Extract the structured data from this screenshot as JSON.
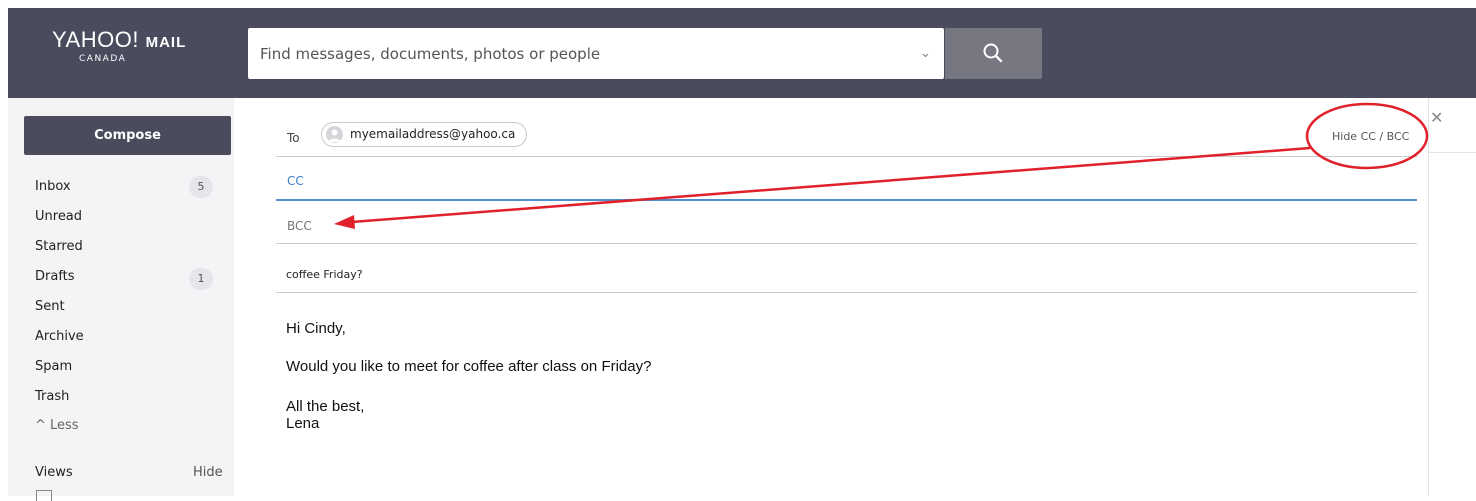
{
  "header": {
    "logo_main": "YAHOO!",
    "logo_mail": "MAIL",
    "logo_sub": "CANADA",
    "search_placeholder": "Find messages, documents, photos or people"
  },
  "sidebar": {
    "compose_label": "Compose",
    "folders": [
      {
        "label": "Inbox",
        "count": "5"
      },
      {
        "label": "Unread"
      },
      {
        "label": "Starred"
      },
      {
        "label": "Drafts",
        "count": "1"
      },
      {
        "label": "Sent"
      },
      {
        "label": "Archive"
      },
      {
        "label": "Spam"
      },
      {
        "label": "Trash"
      }
    ],
    "less_label": "^ Less",
    "views_label": "Views",
    "views_toggle": "Hide"
  },
  "compose_form": {
    "to_label": "To",
    "to_recipient": "myemailaddress@yahoo.ca",
    "toggle_cc_bcc": "Hide CC / BCC",
    "cc_label": "CC",
    "bcc_label": "BCC",
    "subject": "coffee Friday?",
    "body": {
      "greeting": "Hi Cindy,",
      "line1": "Would you like to meet for coffee after class on Friday?",
      "closing": "All the best,",
      "signature": "Lena"
    }
  },
  "colors": {
    "header_bg": "#4b4b5e",
    "accent_blue": "#4d8fd1",
    "annotation_red": "#e0202a"
  },
  "icons": [
    "search-icon",
    "chevron-down-icon",
    "close-icon",
    "avatar-icon"
  ]
}
